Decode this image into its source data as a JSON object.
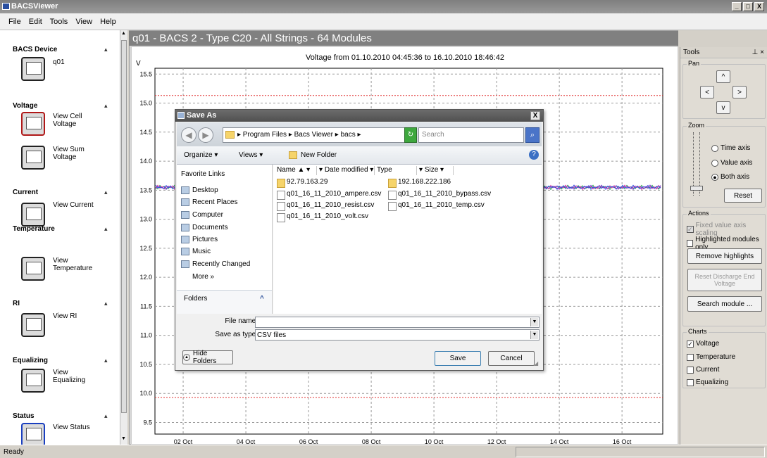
{
  "window": {
    "title": "BACSViewer",
    "buttons": [
      "_",
      "□",
      "X"
    ]
  },
  "menu": [
    "File",
    "Edit",
    "Tools",
    "View",
    "Help"
  ],
  "sidebar": {
    "sections": [
      {
        "header": "BACS Device",
        "items": [
          "q01"
        ]
      },
      {
        "header": "Voltage",
        "items": [
          "View Cell Voltage",
          "View Sum Voltage"
        ]
      },
      {
        "header": "Current",
        "items": [
          "View Current"
        ]
      },
      {
        "header": "Temperature",
        "items": [
          "View Temperature"
        ]
      },
      {
        "header": "RI",
        "items": [
          "View RI"
        ]
      },
      {
        "header": "Equalizing",
        "items": [
          "View Equalizing"
        ]
      },
      {
        "header": "Status",
        "items": [
          "View Status"
        ]
      }
    ]
  },
  "chart": {
    "panel_title": "q01 - BACS 2 - Type C20 - All Strings - 64 Modules"
  },
  "chart_data": {
    "type": "line",
    "title": "Voltage from 01.10.2010 04:45:36 to 16.10.2010 18:46:42",
    "ylabel": "V",
    "ylim": [
      9.3,
      15.6
    ],
    "yticks": [
      "15.5",
      "15.0",
      "14.5",
      "14.0",
      "13.5",
      "13.0",
      "12.5",
      "12.0",
      "11.5",
      "11.0",
      "10.5",
      "10.0",
      "9.5"
    ],
    "xticks": [
      "02 Oct",
      "04 Oct",
      "06 Oct",
      "08 Oct",
      "10 Oct",
      "12 Oct",
      "14 Oct",
      "16 Oct"
    ],
    "limits": [
      {
        "value": 15.13,
        "color": "#e03030"
      },
      {
        "value": 9.93,
        "color": "#e03030"
      }
    ],
    "band_values": [
      13.5,
      13.6
    ],
    "band_colors": [
      "#2aa84a",
      "#6a3fd0",
      "#e040a0",
      "#3050e0"
    ],
    "grid": true
  },
  "tools": {
    "title": "Tools",
    "pin": "⊥ ×",
    "pan": {
      "legend": "Pan",
      "up": "^",
      "left": "<",
      "right": ">",
      "down": "v"
    },
    "zoom": {
      "legend": "Zoom",
      "options": [
        "Time axis",
        "Value axis",
        "Both axis"
      ],
      "selected": "Both axis",
      "reset": "Reset"
    },
    "actions": {
      "legend": "Actions",
      "checks": [
        {
          "label": "Fixed value axis scaling",
          "checked": true,
          "disabled": true
        },
        {
          "label": "Highlighted modules only",
          "checked": false
        }
      ],
      "buttons": [
        "Remove highlights",
        "Reset Discharge End Voltage",
        "Search module ..."
      ]
    },
    "charts": {
      "legend": "Charts",
      "checks": [
        {
          "label": "Voltage",
          "checked": true
        },
        {
          "label": "Temperature",
          "checked": false
        },
        {
          "label": "Current",
          "checked": false
        },
        {
          "label": "Equalizing",
          "checked": false
        }
      ]
    }
  },
  "status": {
    "text": "Ready"
  },
  "dialog": {
    "title": "Save As",
    "close": "X",
    "breadcrumb": "▸ Program Files ▸ Bacs Viewer ▸ bacs ▸",
    "search_placeholder": "Search",
    "toolbar": [
      "Organize ▾",
      "Views ▾",
      "New Folder"
    ],
    "help": "?",
    "favorites_header": "Favorite Links",
    "favorites": [
      "Desktop",
      "Recent Places",
      "Computer",
      "Documents",
      "Pictures",
      "Music",
      "Recently Changed"
    ],
    "more": "More  »",
    "folders": "Folders",
    "folders_chevron": "^",
    "columns": [
      "Name",
      "Date modified",
      "Type",
      "Size"
    ],
    "files": [
      {
        "name": "92.79.163.29",
        "folder": true
      },
      {
        "name": "192.168.222.186",
        "folder": true
      },
      {
        "name": "q01_16_11_2010_ampere.csv",
        "folder": false
      },
      {
        "name": "q01_16_11_2010_bypass.csv",
        "folder": false
      },
      {
        "name": "q01_16_11_2010_resist.csv",
        "folder": false
      },
      {
        "name": "q01_16_11_2010_temp.csv",
        "folder": false
      },
      {
        "name": "q01_16_11_2010_volt.csv",
        "folder": false
      }
    ],
    "file_name_label": "File name:",
    "file_name_value": "",
    "save_type_label": "Save as type:",
    "save_type_value": "CSV files",
    "hide_folders": "Hide Folders",
    "save": "Save",
    "cancel": "Cancel"
  }
}
